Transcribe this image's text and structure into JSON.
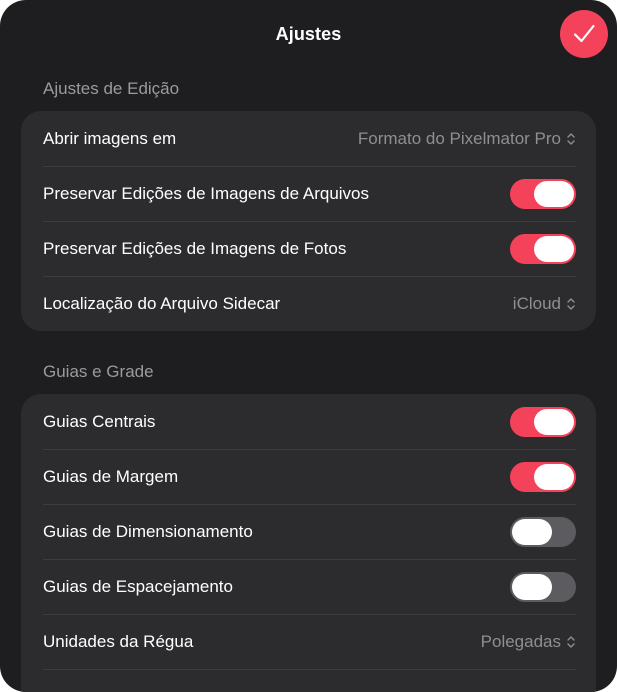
{
  "header": {
    "title": "Ajustes",
    "done_icon": "checkmark-icon"
  },
  "accent_color": "#f5425b",
  "sections": [
    {
      "title": "Ajustes de Edição",
      "rows": [
        {
          "label": "Abrir imagens em",
          "value": "Formato do Pixelmator Pro",
          "type": "select"
        },
        {
          "label": "Preservar Edições de Imagens de Arquivos",
          "on": true,
          "type": "toggle"
        },
        {
          "label": "Preservar Edições de Imagens de Fotos",
          "on": true,
          "type": "toggle"
        },
        {
          "label": "Localização do Arquivo Sidecar",
          "value": "iCloud",
          "type": "select"
        }
      ]
    },
    {
      "title": "Guias e Grade",
      "rows": [
        {
          "label": "Guias Centrais",
          "on": true,
          "type": "toggle"
        },
        {
          "label": "Guias de Margem",
          "on": true,
          "type": "toggle"
        },
        {
          "label": "Guias de Dimensionamento",
          "on": false,
          "type": "toggle"
        },
        {
          "label": "Guias de Espacejamento",
          "on": false,
          "type": "toggle"
        },
        {
          "label": "Unidades da Régua",
          "value": "Polegadas",
          "type": "select"
        }
      ]
    }
  ]
}
